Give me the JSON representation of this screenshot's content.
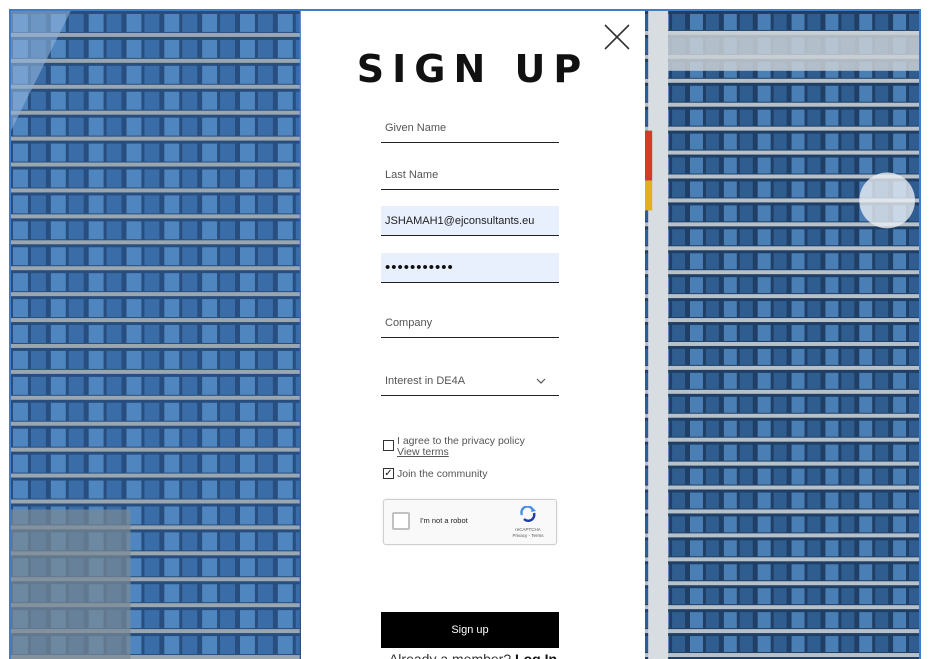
{
  "modal": {
    "title": "SIGN UP",
    "fields": {
      "given_name_placeholder": "Given Name",
      "last_name_placeholder": "Last Name",
      "email_value": "JSHAMAH1@ejconsultants.eu",
      "password_masked": "•••••••••••",
      "company_placeholder": "Company",
      "interest_selected": "Interest in DE4A"
    },
    "checkboxes": {
      "privacy_label": "I agree to the privacy policy",
      "privacy_link": "View terms",
      "privacy_checked": false,
      "community_label": "Join the community",
      "community_checked": true
    },
    "captcha": {
      "label": "I'm not a robot",
      "brand": "reCAPTCHA",
      "links": "Privacy - Terms"
    },
    "submit_label": "Sign up",
    "member_prompt": "Already a member?",
    "login_label": "Log In"
  },
  "icons": {
    "close": "close-icon",
    "dropdown": "chevron-down-icon",
    "captcha": "recaptcha-logo-icon"
  },
  "colors": {
    "button_bg": "#000000",
    "autofill_bg": "#e8f0fd",
    "frame_border": "#3f7dc7"
  }
}
